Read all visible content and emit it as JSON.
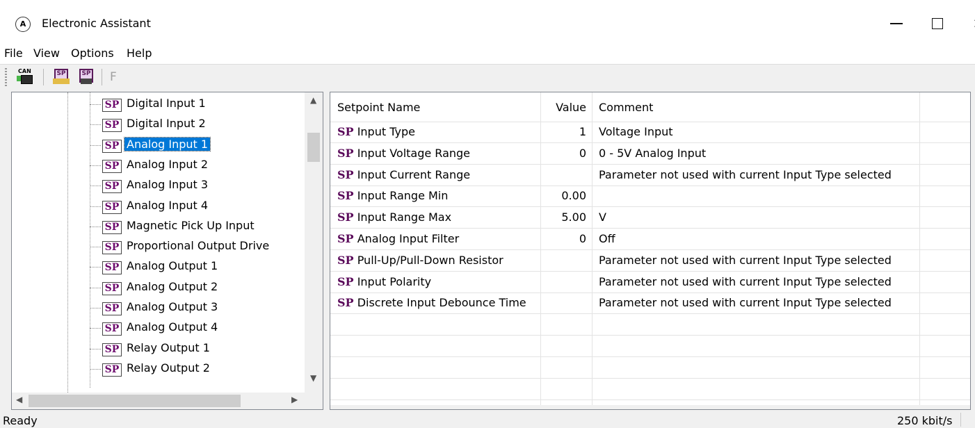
{
  "window": {
    "title": "Electronic Assistant",
    "icon": "app-logo-icon"
  },
  "menu": [
    "File",
    "View",
    "Options",
    "Help"
  ],
  "toolbar": {
    "can_label": "CAN",
    "sp_label": "SP",
    "f_label": "F"
  },
  "tree": {
    "items": [
      "Digital Input 1",
      "Digital Input 2",
      "Analog Input 1",
      "Analog Input 2",
      "Analog Input 3",
      "Analog Input 4",
      "Magnetic Pick Up Input",
      "Proportional Output Drive",
      "Analog Output 1",
      "Analog Output 2",
      "Analog Output 3",
      "Analog Output 4",
      "Relay Output 1",
      "Relay Output 2"
    ],
    "selected": "Analog Input 1",
    "sp_badge": "SP"
  },
  "grid": {
    "headers": {
      "name": "Setpoint Name",
      "value": "Value",
      "comment": "Comment"
    },
    "sp_prefix": "SP",
    "rows": [
      {
        "name": "Input Type",
        "value": "1",
        "comment": "Voltage Input"
      },
      {
        "name": "Input Voltage Range",
        "value": "0",
        "comment": "0 - 5V Analog Input"
      },
      {
        "name": "Input Current Range",
        "value": "",
        "comment": "Parameter not used with current Input Type selected"
      },
      {
        "name": "Input Range Min",
        "value": "0.00",
        "comment": ""
      },
      {
        "name": "Input Range Max",
        "value": "5.00",
        "comment": "V"
      },
      {
        "name": "Analog Input Filter",
        "value": "0",
        "comment": "Off"
      },
      {
        "name": "Pull-Up/Pull-Down Resistor",
        "value": "",
        "comment": "Parameter not used with current Input Type selected"
      },
      {
        "name": "Input Polarity",
        "value": "",
        "comment": "Parameter not used with current Input Type selected"
      },
      {
        "name": "Discrete Input Debounce Time",
        "value": "",
        "comment": "Parameter not used with current Input Type selected"
      }
    ]
  },
  "status": {
    "left": "Ready",
    "right": "250 kbit/s"
  }
}
